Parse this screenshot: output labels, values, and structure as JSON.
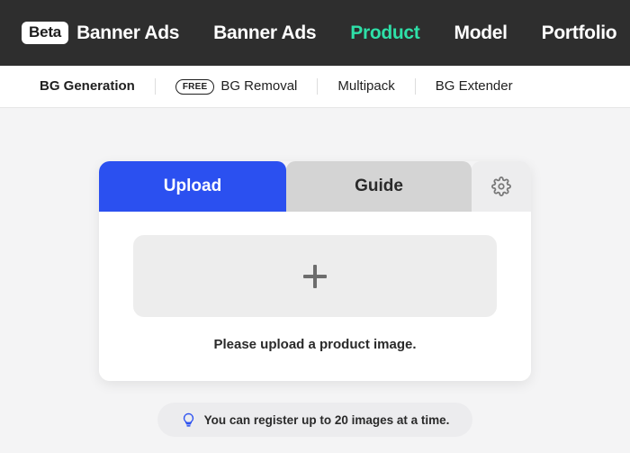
{
  "header": {
    "badge": "Beta",
    "brand": "Banner Ads",
    "nav": [
      {
        "label": "Banner Ads",
        "active": false
      },
      {
        "label": "Product",
        "active": true
      },
      {
        "label": "Model",
        "active": false
      },
      {
        "label": "Portfolio",
        "active": false
      }
    ],
    "background_color": "#2e2e2e",
    "accent_color": "#2ee0a8"
  },
  "subnav": {
    "items": [
      {
        "label": "BG Generation",
        "badge": "",
        "active": true
      },
      {
        "label": "BG Removal",
        "badge": "FREE",
        "active": false
      },
      {
        "label": "Multipack",
        "badge": "",
        "active": false
      },
      {
        "label": "BG Extender",
        "badge": "",
        "active": false
      }
    ],
    "active_highlight_color": "#bdf4e0"
  },
  "card": {
    "tabs": [
      {
        "label": "Upload",
        "active": true
      },
      {
        "label": "Guide",
        "active": false
      },
      {
        "label": "",
        "icon": "gear-icon",
        "active": false
      }
    ],
    "active_tab_color": "#2b50f0",
    "dropzone": {
      "icon": "plus-icon",
      "message": "Please upload a product image."
    }
  },
  "notice": {
    "icon": "lightbulb-icon",
    "text": "You can register up to 20 images at a time.",
    "icon_color": "#2b50f0"
  }
}
